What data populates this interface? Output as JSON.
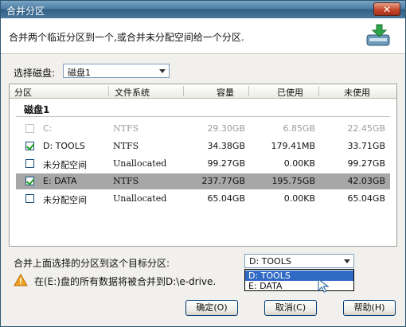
{
  "window": {
    "title": "合并分区",
    "close_label": "✕"
  },
  "header": {
    "description": "合并两个临近分区到一个,或合并未分配空间给一个分区."
  },
  "disk_select": {
    "label": "选择磁盘:",
    "value": "磁盘1"
  },
  "table": {
    "columns": [
      "分区",
      "文件系统",
      "容量",
      "已使用",
      "未使用"
    ],
    "group_label": "磁盘1",
    "rows": [
      {
        "name": "C:",
        "fs": "NTFS",
        "capacity": "29.30GB",
        "used": "6.85GB",
        "free": "22.45GB",
        "checked": false,
        "disabled": true,
        "selected": false
      },
      {
        "name": "D:  TOOLS",
        "fs": "NTFS",
        "capacity": "34.38GB",
        "used": "179.41MB",
        "free": "33.71GB",
        "checked": true,
        "disabled": false,
        "selected": false
      },
      {
        "name": "未分配空间",
        "fs": "Unallocated",
        "capacity": "99.27GB",
        "used": "0.00KB",
        "free": "99.27GB",
        "checked": false,
        "disabled": false,
        "selected": false
      },
      {
        "name": "E:  DATA",
        "fs": "NTFS",
        "capacity": "237.77GB",
        "used": "195.75GB",
        "free": "42.03GB",
        "checked": true,
        "disabled": false,
        "selected": true
      },
      {
        "name": "未分配空间",
        "fs": "Unallocated",
        "capacity": "65.04GB",
        "used": "0.00KB",
        "free": "65.04GB",
        "checked": false,
        "disabled": false,
        "selected": false
      }
    ]
  },
  "target": {
    "label": "合并上面选择的分区到这个目标分区:",
    "value": "D:  TOOLS",
    "options": [
      "D:  TOOLS",
      "E:  DATA"
    ],
    "highlighted_index": 0
  },
  "warning": {
    "text": "在(E:)盘的所有数据将被合并到D:\\e-drive."
  },
  "buttons": {
    "ok": "确定(O)",
    "cancel": "取消(C)",
    "help": "帮助(H)"
  },
  "colors": {
    "titlebar": "#4f7fa4",
    "selection": "#a7a7a7",
    "highlight": "#316ac5",
    "check": "#21a121"
  }
}
